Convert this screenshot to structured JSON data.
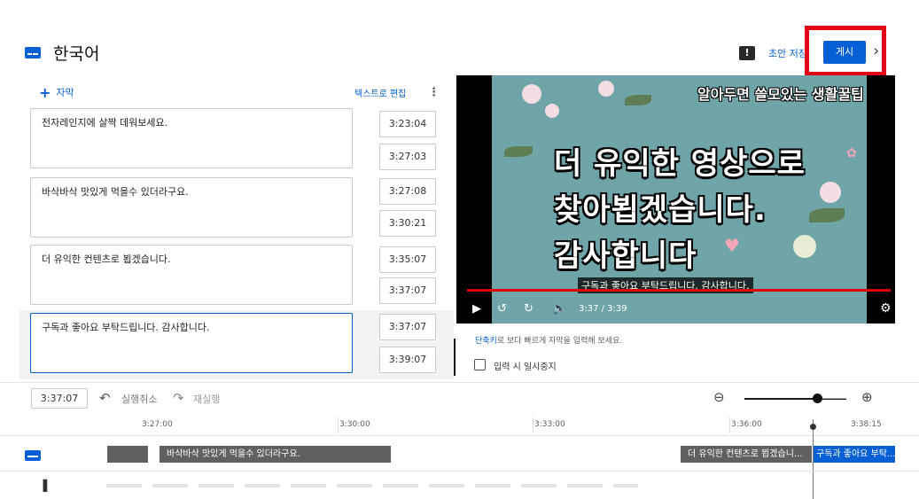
{
  "header": {
    "language": "한국어",
    "feedback_icon": "feedback-icon",
    "save_draft": "초안 저장",
    "publish": "게시",
    "close_icon": "close-icon"
  },
  "editor": {
    "add_caption": "자막",
    "edit_as_text": "텍스트로 편집",
    "captions": [
      {
        "text": "전자레인지에 살짝 데워보세요.",
        "start": "3:23:04",
        "end": "3:27:03"
      },
      {
        "text": "바삭바삭 맛있게 먹을수 있더라구요.",
        "start": "3:27:08",
        "end": "3:30:21"
      },
      {
        "text": "더 유익한 컨텐츠로 뵙겠습니다.",
        "start": "3:35:07",
        "end": "3:37:07"
      },
      {
        "text": "구독과 좋아요 부탁드립니다. 감사합니다.",
        "start": "3:37:07",
        "end": "3:39:07"
      }
    ]
  },
  "video": {
    "overlay_top": "알아두면 쓸모있는 생활꿀팁",
    "line1": "더 유익한 영상으로",
    "line2": "찾아뵙겠습니다.",
    "line3": "감사합니다",
    "caption_preview": "구독과 좋아요 부탁드립니다. 감사합니다.",
    "time": "3:37 / 3:39",
    "progress_percent": 99
  },
  "shortcuts": {
    "link": "단축키",
    "rest": "로 보다 빠르게 자막을 입력해 보세요.",
    "pause_label": "입력 시 일시중지",
    "pause_checked": false
  },
  "toolbar": {
    "current_time": "3:37:07",
    "undo": "실행취소",
    "redo": "재실행"
  },
  "timeline": {
    "ticks": [
      "3:27:00",
      "3:30:00",
      "3:33:00",
      "3:36:00",
      "3:38:15"
    ],
    "segments": [
      {
        "text": ""
      },
      {
        "text": "바삭바삭 맛있게 먹을수 있더라구요."
      },
      {
        "text": "더 유익한 컨텐츠로 뵙겠습니..."
      },
      {
        "text": "구독과 좋아요 부탁..."
      }
    ]
  },
  "colors": {
    "accent": "#065fd4",
    "highlight": "#e5001a",
    "progress": "#e00000"
  }
}
